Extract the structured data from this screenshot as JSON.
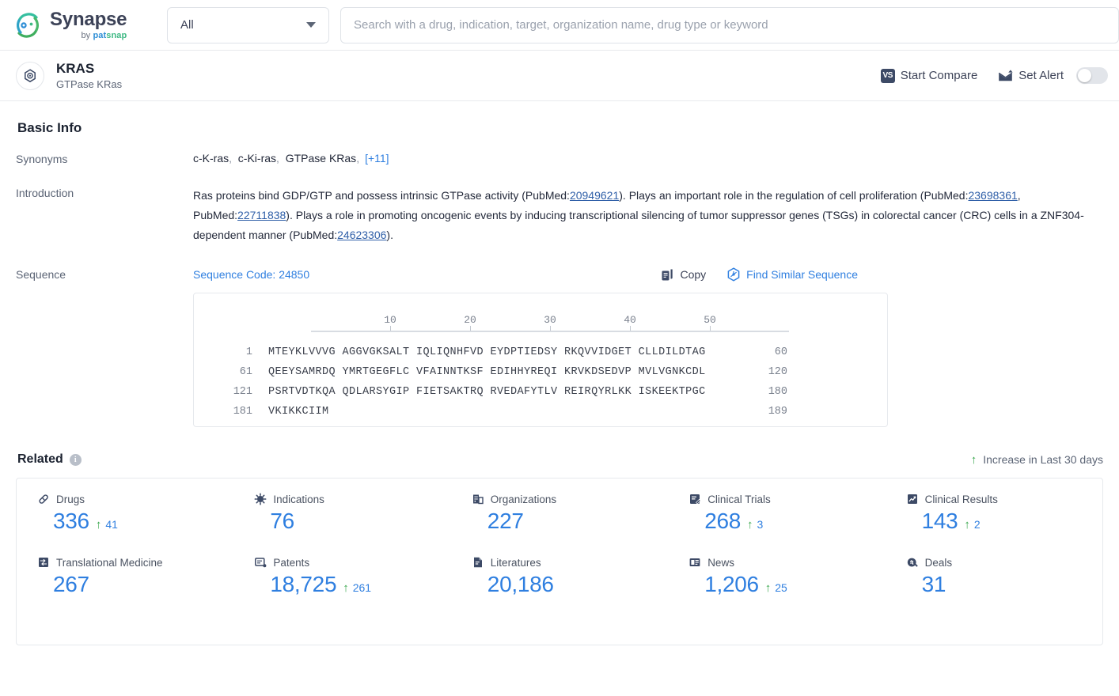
{
  "topbar": {
    "logo": {
      "title": "Synapse",
      "by": "by ",
      "pat": "pat",
      "snap": "snap"
    },
    "category_select": {
      "value": "All",
      "icon": "chevron-down-icon"
    },
    "search": {
      "value": "",
      "placeholder": "Search with a drug, indication, target, organization name, drug type or keyword"
    }
  },
  "entity": {
    "icon": "target-icon",
    "title": "KRAS",
    "subtitle": "GTPase KRas",
    "start_compare": {
      "label": "Start Compare",
      "icon": "vs-icon",
      "badge": "VS"
    },
    "set_alert": {
      "label": "Set Alert",
      "icon": "alert-mail-icon",
      "enabled": false
    }
  },
  "basic_info": {
    "section_title": "Basic Info",
    "synonyms": {
      "label": "Synonyms",
      "items": [
        "c-K-ras",
        "c-Ki-ras",
        "GTPase KRas"
      ],
      "more": "[+11]"
    },
    "introduction": {
      "label": "Introduction",
      "parts": [
        {
          "t": "Ras proteins bind GDP/GTP and possess intrinsic GTPase activity (PubMed:",
          "link": false
        },
        {
          "t": "20949621",
          "link": true
        },
        {
          "t": "). Plays an important role in the regulation of cell proliferation (PubMed:",
          "link": false
        },
        {
          "t": "23698361",
          "link": true
        },
        {
          "t": ", PubMed:",
          "link": false
        },
        {
          "t": "22711838",
          "link": true
        },
        {
          "t": "). Plays a role in promoting oncogenic events by inducing transcriptional silencing of tumor suppressor genes (TSGs) in colorectal cancer (CRC) cells in a ZNF304-dependent manner (PubMed:",
          "link": false
        },
        {
          "t": "24623306",
          "link": true
        },
        {
          "t": ").",
          "link": false
        }
      ]
    },
    "sequence": {
      "label": "Sequence",
      "code_text": "Sequence Code: 24850",
      "copy_label": "Copy",
      "copy_icon": "copy-icon",
      "similar_label": "Find Similar Sequence",
      "similar_icon": "find-similar-icon",
      "ruler_ticks": [
        "10",
        "20",
        "30",
        "40",
        "50"
      ],
      "lines": [
        {
          "start": "1",
          "residues": "MTEYKLVVVG AGGVGKSALT IQLIQNHFVD EYDPTIEDSY RKQVVIDGET CLLDILDTAG",
          "end": "60"
        },
        {
          "start": "61",
          "residues": "QEEYSAMRDQ YMRTGEGFLC VFAINNTKSF EDIHHYREQI KRVKDSEDVP MVLVGNKCDL",
          "end": "120"
        },
        {
          "start": "121",
          "residues": "PSRTVDTKQA QDLARSYGIP FIETSAKTRQ RVEDAFYTLV REIRQYRLKK ISKEEKTPGC",
          "end": "180"
        },
        {
          "start": "181",
          "residues": "VKIKKCIIM",
          "end": "189"
        }
      ]
    }
  },
  "related": {
    "title": "Related",
    "info_icon": "info-icon",
    "legend": {
      "arrow": "↑",
      "text": "Increase in Last 30 days"
    },
    "stats": [
      {
        "label": "Drugs",
        "icon": "capsule-icon",
        "value": "336",
        "delta": "41"
      },
      {
        "label": "Indications",
        "icon": "virus-icon",
        "value": "76",
        "delta": ""
      },
      {
        "label": "Organizations",
        "icon": "building-icon",
        "value": "227",
        "delta": ""
      },
      {
        "label": "Clinical Trials",
        "icon": "trial-icon",
        "value": "268",
        "delta": "3"
      },
      {
        "label": "Clinical Results",
        "icon": "results-icon",
        "value": "143",
        "delta": "2"
      },
      {
        "label": "Translational Medicine",
        "icon": "translational-icon",
        "value": "267",
        "delta": ""
      },
      {
        "label": "Patents",
        "icon": "patent-icon",
        "value": "18,725",
        "delta": "261"
      },
      {
        "label": "Literatures",
        "icon": "literature-icon",
        "value": "20,186",
        "delta": ""
      },
      {
        "label": "News",
        "icon": "news-icon",
        "value": "1,206",
        "delta": "25"
      },
      {
        "label": "Deals",
        "icon": "deals-icon",
        "value": "31",
        "delta": ""
      }
    ]
  },
  "colors": {
    "link_blue": "#2f7fe0",
    "value_blue": "#2f7fe0",
    "increase_green": "#3aa84e",
    "icon_dark": "#3d4a66",
    "text_dark": "#1b2230",
    "label_gray": "#5b6475"
  }
}
